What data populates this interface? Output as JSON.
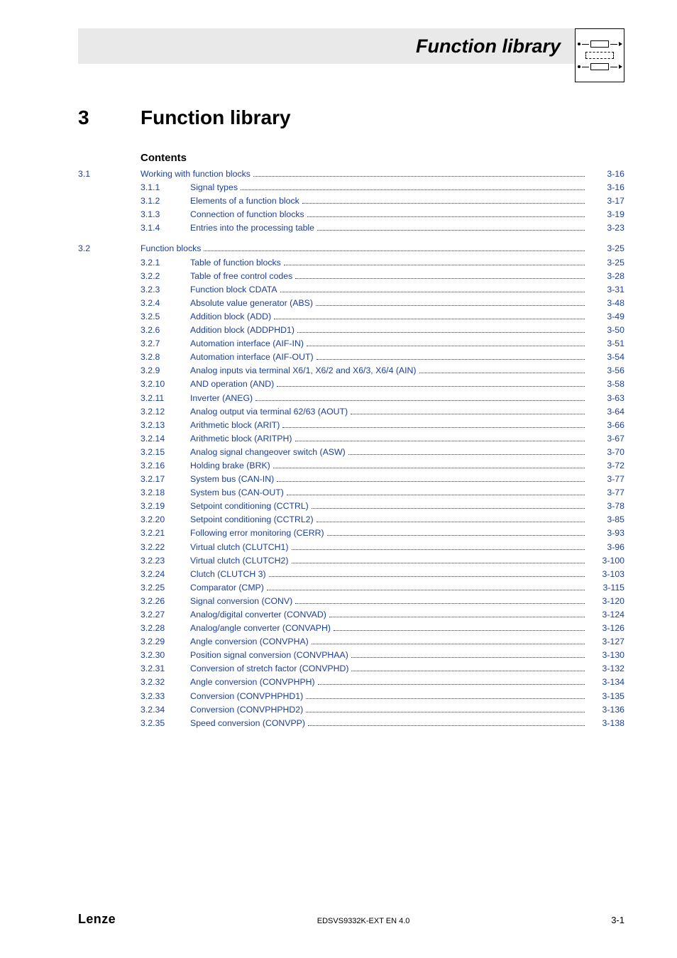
{
  "header": {
    "title": "Function library"
  },
  "chapter": {
    "number": "3",
    "title": "Function library"
  },
  "contents_label": "Contents",
  "toc": [
    {
      "level": 1,
      "num": "3.1",
      "title": "Working with function blocks",
      "page": "3-16"
    },
    {
      "level": 2,
      "num": "3.1.1",
      "title": "Signal types",
      "page": "3-16"
    },
    {
      "level": 2,
      "num": "3.1.2",
      "title": "Elements of a function block",
      "page": "3-17"
    },
    {
      "level": 2,
      "num": "3.1.3",
      "title": "Connection of function blocks",
      "page": "3-19"
    },
    {
      "level": 2,
      "num": "3.1.4",
      "title": "Entries into the processing table",
      "page": "3-23"
    },
    {
      "level": 0
    },
    {
      "level": 1,
      "num": "3.2",
      "title": "Function blocks",
      "page": "3-25"
    },
    {
      "level": 2,
      "num": "3.2.1",
      "title": "Table of function blocks",
      "page": "3-25"
    },
    {
      "level": 2,
      "num": "3.2.2",
      "title": "Table of free control codes",
      "page": "3-28"
    },
    {
      "level": 2,
      "num": "3.2.3",
      "title": "Function block CDATA",
      "page": "3-31"
    },
    {
      "level": 2,
      "num": "3.2.4",
      "title": "Absolute value generator (ABS)",
      "page": "3-48"
    },
    {
      "level": 2,
      "num": "3.2.5",
      "title": "Addition block (ADD)",
      "page": "3-49"
    },
    {
      "level": 2,
      "num": "3.2.6",
      "title": "Addition block (ADDPHD1)",
      "page": "3-50"
    },
    {
      "level": 2,
      "num": "3.2.7",
      "title": "Automation interface (AIF-IN)",
      "page": "3-51"
    },
    {
      "level": 2,
      "num": "3.2.8",
      "title": "Automation interface (AIF-OUT)",
      "page": "3-54"
    },
    {
      "level": 2,
      "num": "3.2.9",
      "title": "Analog inputs via terminal X6/1, X6/2 and X6/3, X6/4 (AIN)",
      "page": "3-56"
    },
    {
      "level": 2,
      "num": "3.2.10",
      "title": "AND operation (AND)",
      "page": "3-58"
    },
    {
      "level": 2,
      "num": "3.2.11",
      "title": "Inverter (ANEG)",
      "page": "3-63"
    },
    {
      "level": 2,
      "num": "3.2.12",
      "title": "Analog output via terminal 62/63 (AOUT)",
      "page": "3-64"
    },
    {
      "level": 2,
      "num": "3.2.13",
      "title": "Arithmetic block (ARIT)",
      "page": "3-66"
    },
    {
      "level": 2,
      "num": "3.2.14",
      "title": "Arithmetic block (ARITPH)",
      "page": "3-67"
    },
    {
      "level": 2,
      "num": "3.2.15",
      "title": "Analog signal changeover switch (ASW)",
      "page": "3-70"
    },
    {
      "level": 2,
      "num": "3.2.16",
      "title": "Holding brake (BRK)",
      "page": "3-72"
    },
    {
      "level": 2,
      "num": "3.2.17",
      "title": "System bus (CAN-IN)",
      "page": "3-77"
    },
    {
      "level": 2,
      "num": "3.2.18",
      "title": "System bus (CAN-OUT)",
      "page": "3-77"
    },
    {
      "level": 2,
      "num": "3.2.19",
      "title": "Setpoint conditioning (CCTRL)",
      "page": "3-78"
    },
    {
      "level": 2,
      "num": "3.2.20",
      "title": "Setpoint conditioning (CCTRL2)",
      "page": "3-85"
    },
    {
      "level": 2,
      "num": "3.2.21",
      "title": "Following error monitoring (CERR)",
      "page": "3-93"
    },
    {
      "level": 2,
      "num": "3.2.22",
      "title": "Virtual clutch (CLUTCH1)",
      "page": "3-96"
    },
    {
      "level": 2,
      "num": "3.2.23",
      "title": "Virtual clutch (CLUTCH2)",
      "page": "3-100"
    },
    {
      "level": 2,
      "num": "3.2.24",
      "title": "Clutch (CLUTCH 3)",
      "page": "3-103"
    },
    {
      "level": 2,
      "num": "3.2.25",
      "title": "Comparator (CMP)",
      "page": "3-115"
    },
    {
      "level": 2,
      "num": "3.2.26",
      "title": "Signal conversion (CONV)",
      "page": "3-120"
    },
    {
      "level": 2,
      "num": "3.2.27",
      "title": "Analog/digital converter (CONVAD)",
      "page": "3-124"
    },
    {
      "level": 2,
      "num": "3.2.28",
      "title": "Analog/angle converter (CONVAPH)",
      "page": "3-126"
    },
    {
      "level": 2,
      "num": "3.2.29",
      "title": "Angle conversion (CONVPHA)",
      "page": "3-127"
    },
    {
      "level": 2,
      "num": "3.2.30",
      "title": "Position signal conversion (CONVPHAA)",
      "page": "3-130"
    },
    {
      "level": 2,
      "num": "3.2.31",
      "title": "Conversion of stretch factor (CONVPHD)",
      "page": "3-132"
    },
    {
      "level": 2,
      "num": "3.2.32",
      "title": "Angle conversion (CONVPHPH)",
      "page": "3-134"
    },
    {
      "level": 2,
      "num": "3.2.33",
      "title": "Conversion (CONVPHPHD1)",
      "page": "3-135"
    },
    {
      "level": 2,
      "num": "3.2.34",
      "title": "Conversion (CONVPHPHD2)",
      "page": "3-136"
    },
    {
      "level": 2,
      "num": "3.2.35",
      "title": "Speed conversion (CONVPP)",
      "page": "3-138"
    }
  ],
  "footer": {
    "brand": "Lenze",
    "doc": "EDSVS9332K-EXT EN 4.0",
    "page": "3-1"
  }
}
